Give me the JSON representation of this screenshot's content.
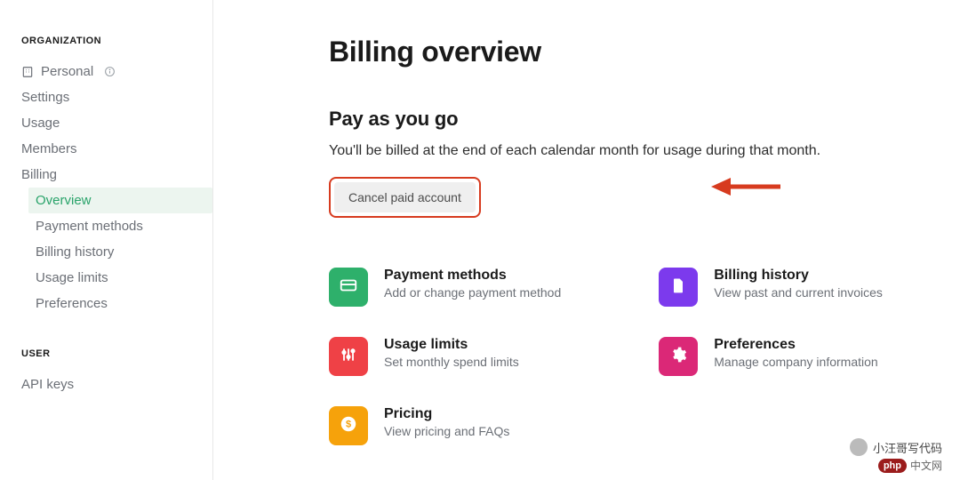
{
  "sidebar": {
    "org_header": "ORGANIZATION",
    "personal_label": "Personal",
    "items": [
      "Settings",
      "Usage",
      "Members",
      "Billing"
    ],
    "billing_sub": [
      "Overview",
      "Payment methods",
      "Billing history",
      "Usage limits",
      "Preferences"
    ],
    "active_sub_index": 0,
    "user_header": "USER",
    "user_items": [
      "API keys"
    ]
  },
  "main": {
    "title": "Billing overview",
    "section_title": "Pay as you go",
    "section_desc": "You'll be billed at the end of each calendar month for usage during that month.",
    "cancel_label": "Cancel paid account"
  },
  "cards": {
    "left": [
      {
        "title": "Payment methods",
        "desc": "Add or change payment method",
        "color": "green",
        "icon": "card"
      },
      {
        "title": "Usage limits",
        "desc": "Set monthly spend limits",
        "color": "red",
        "icon": "sliders"
      },
      {
        "title": "Pricing",
        "desc": "View pricing and FAQs",
        "color": "orange",
        "icon": "dollar"
      }
    ],
    "right": [
      {
        "title": "Billing history",
        "desc": "View past and current invoices",
        "color": "purple",
        "icon": "file"
      },
      {
        "title": "Preferences",
        "desc": "Manage company information",
        "color": "pink",
        "icon": "gear"
      }
    ]
  },
  "watermark": {
    "line1": "小汪哥写代码",
    "pill": "php",
    "line2": "中文网"
  }
}
